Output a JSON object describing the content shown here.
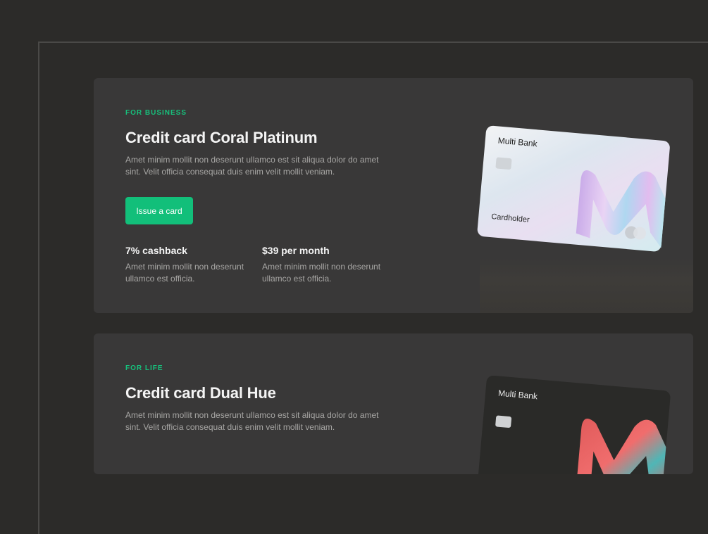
{
  "colors": {
    "background": "#2c2b29",
    "panel": "#393838",
    "accent": "#12bf7a",
    "muted_text": "#a7a6a4"
  },
  "cards": [
    {
      "eyebrow": "FOR BUSINESS",
      "title": "Credit card Coral Platinum",
      "description": "Amet minim mollit non deserunt ullamco est sit aliqua dolor do amet sint. Velit officia consequat duis enim velit mollit veniam.",
      "button_label": "Issue a card",
      "features": [
        {
          "title": "7% cashback",
          "text": "Amet minim mollit non deserunt ullamco est officia."
        },
        {
          "title": "$39 per month",
          "text": "Amet minim mollit non deserunt ullamco est officia."
        }
      ],
      "card_image": {
        "bank_name": "Multi Bank",
        "holder_label": "Cardholder",
        "style": "holographic"
      }
    },
    {
      "eyebrow": "FOR LIFE",
      "title": "Credit card Dual Hue",
      "description": "Amet minim mollit non deserunt ullamco est sit aliqua dolor do amet sint. Velit officia consequat duis enim velit mollit veniam.",
      "card_image": {
        "bank_name": "Multi Bank",
        "style": "dark"
      }
    }
  ]
}
